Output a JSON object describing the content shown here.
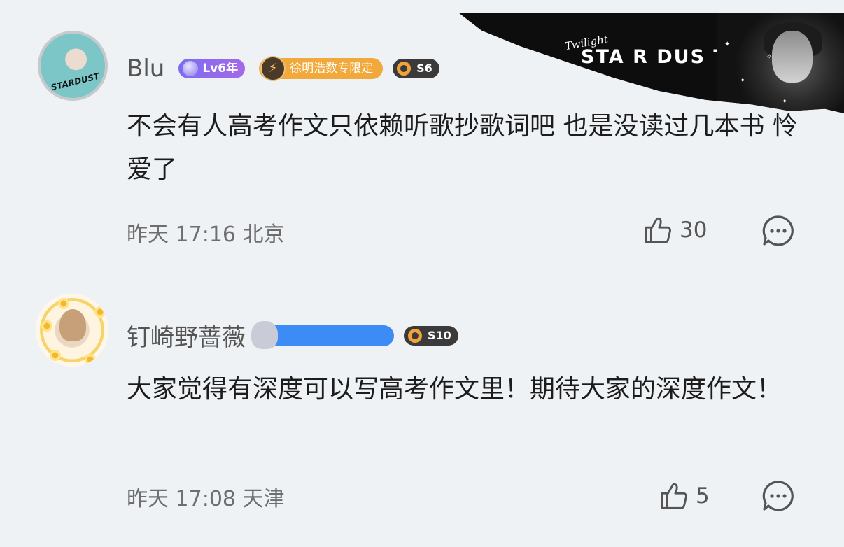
{
  "banner": {
    "script_text": "Twilight",
    "title": "STA R DUS T",
    "icon": "artist-photo-banner"
  },
  "comments": [
    {
      "username": "Blu",
      "avatar_mark": "STARDUST",
      "level_badge": "Lv6年",
      "fan_badge": "徐明浩数专限定",
      "season_badge": "S6",
      "text": "不会有人高考作文只依赖听歌抄歌词吧 也是没读过几本书 怜爱了",
      "time": "昨天 17:16",
      "location": "北京",
      "likes": "30",
      "like_icon": "thumbs-up-icon",
      "reply_icon": "comment-bubble-icon"
    },
    {
      "username": "钉崎野蔷薇",
      "season_badge": "S10",
      "text": "大家觉得有深度可以写高考作文里！期待大家的深度作文！",
      "time": "昨天 17:08",
      "location": "天津",
      "likes": "5",
      "like_icon": "thumbs-up-icon",
      "reply_icon": "comment-bubble-icon"
    }
  ],
  "colors": {
    "background": "#eff2f5",
    "level_badge": "#8a70ec",
    "fan_badge": "#f2a93b",
    "blue_badge": "#3d8cf5",
    "season_badge": "#3a3a3a"
  }
}
